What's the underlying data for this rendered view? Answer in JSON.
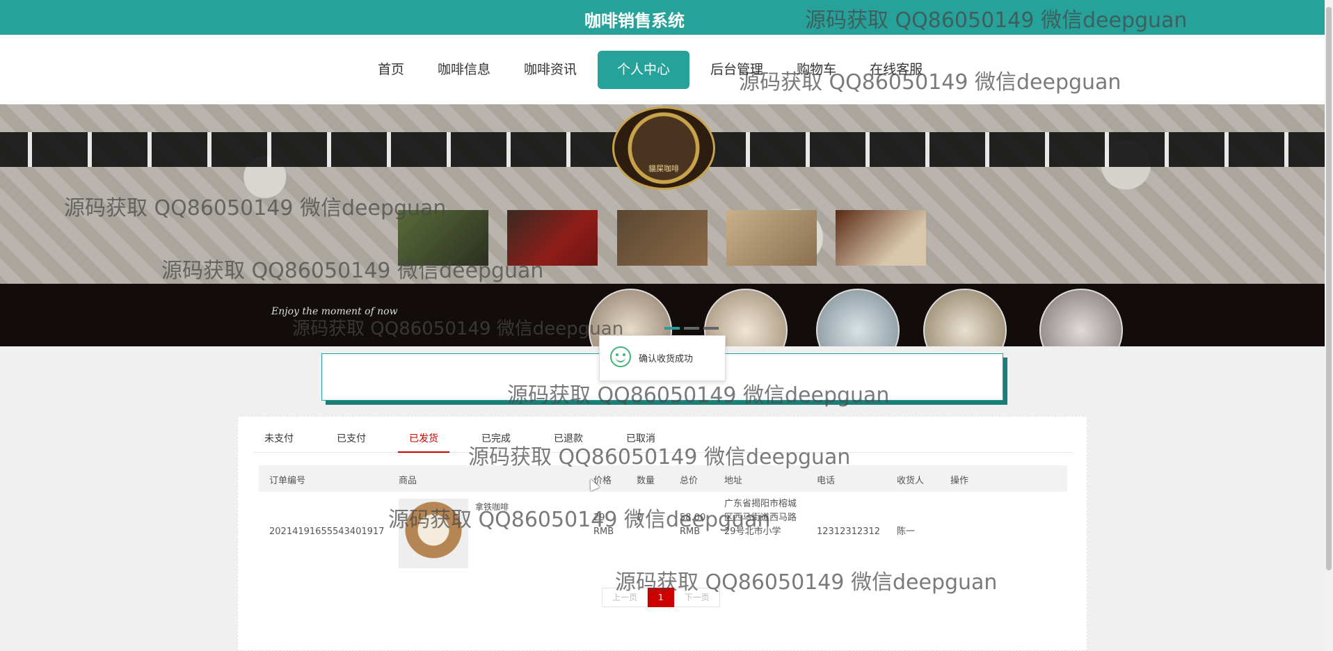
{
  "header": {
    "title": "咖啡销售系统"
  },
  "nav": {
    "items": [
      {
        "label": "首页"
      },
      {
        "label": "咖啡信息"
      },
      {
        "label": "咖啡资讯"
      },
      {
        "label": "个人中心",
        "active": true
      },
      {
        "label": "后台管理"
      },
      {
        "label": "购物车"
      },
      {
        "label": "在线客服"
      }
    ]
  },
  "banner": {
    "slogan": "Enjoy the moment of now",
    "logo_text": "貓屎咖啡"
  },
  "toast": {
    "message": "确认收货成功"
  },
  "orders": {
    "tabs": [
      "未支付",
      "已支付",
      "已发货",
      "已完成",
      "已退款",
      "已取消"
    ],
    "active_tab": "已发货",
    "columns": [
      "订单编号",
      "商品",
      "价格",
      "数量",
      "总价",
      "地址",
      "电话",
      "收货人",
      "操作"
    ],
    "rows": [
      {
        "order_no": "20214191655543401917",
        "product_name": "拿铁咖啡",
        "price": "29 RMB",
        "qty": "2",
        "total": "58.00 RMB",
        "address": "广东省揭阳市榕城区西马街道西马路29号北市小学",
        "phone": "12312312312",
        "receiver": "陈一"
      }
    ]
  },
  "pagination": {
    "prev": "上一页",
    "current": "1",
    "next": "下一页"
  },
  "watermark": {
    "text": "源码获取 QQ86050149 微信deepguan"
  },
  "colors": {
    "primary": "#26a29a",
    "accent": "#cc0000"
  }
}
